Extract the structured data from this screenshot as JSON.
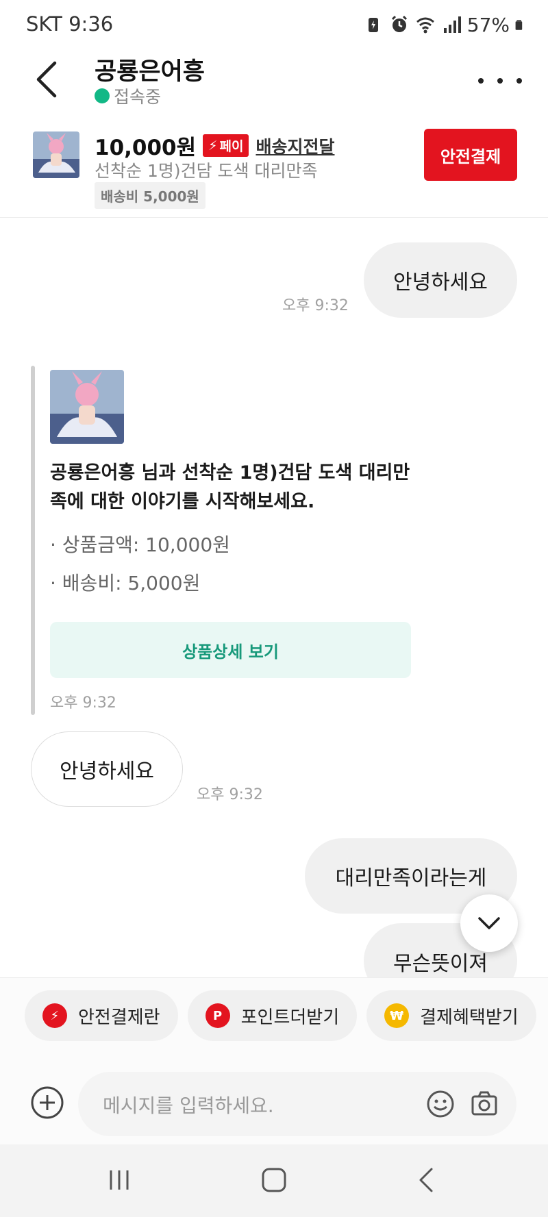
{
  "status_bar": {
    "carrier_time": "SKT 9:36",
    "battery": "57%"
  },
  "header": {
    "title": "공룡은어흥",
    "status": "접속중"
  },
  "product": {
    "price": "10,000원",
    "pay_badge": "페이",
    "shipping_link": "배송지전달",
    "name": "선착순 1명)건담 도색 대리만족",
    "shipping_fee": "배송비 5,000원",
    "safe_pay_button": "안전결제"
  },
  "messages": {
    "m1_text": "안녕하세요",
    "m1_time": "오후 9:32",
    "card_title": "공룡은어흥 님과 선착순 1명)건담 도색 대리만족에 대한 이야기를 시작해보세요.",
    "card_price": "· 상품금액: 10,000원",
    "card_fee": "· 배송비: 5,000원",
    "card_button": "상품상세 보기",
    "card_time": "오후 9:32",
    "m2_text": "안녕하세요",
    "m2_time": "오후 9:32",
    "m3_text": "대리만족이라는게",
    "m4_text": "무슨뜻이져"
  },
  "quick_actions": [
    {
      "label": "안전결제란",
      "color": "#e3141f"
    },
    {
      "label": "포인트더받기",
      "color": "#e3141f"
    },
    {
      "label": "결제혜택받기",
      "color": "#f5b800"
    }
  ],
  "composer": {
    "placeholder": "메시지를 입력하세요."
  },
  "colors": {
    "accent_red": "#e3141f",
    "online_green": "#12b886",
    "detail_button_text": "#17997a"
  }
}
